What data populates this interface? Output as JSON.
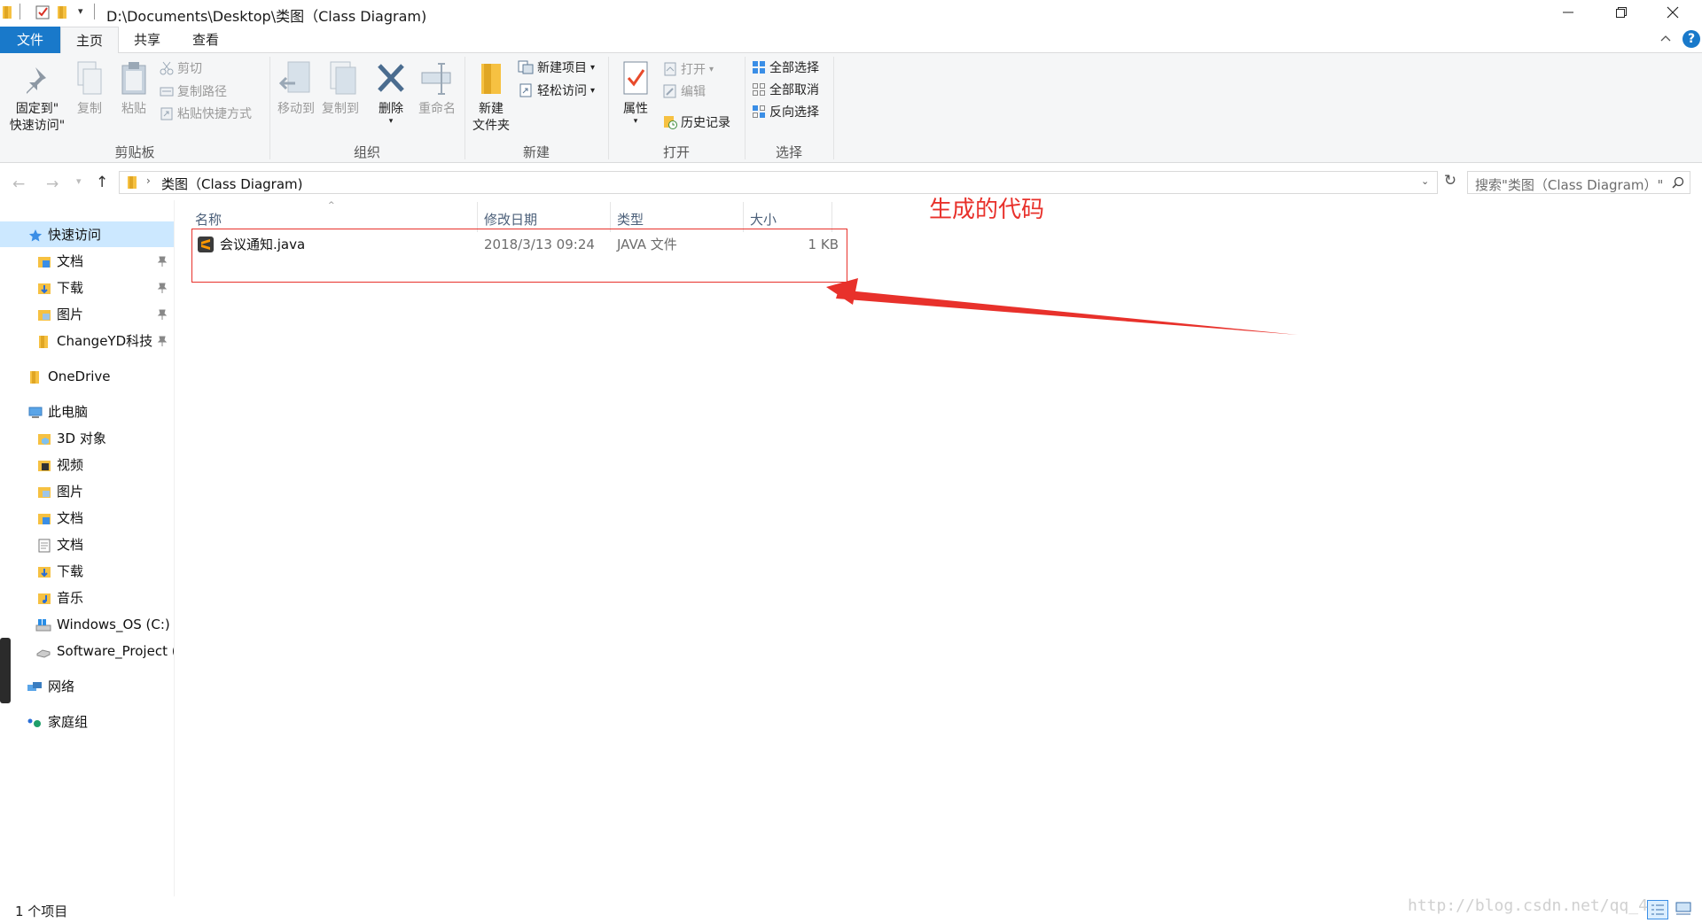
{
  "window": {
    "title": "D:\\Documents\\Desktop\\类图（Class Diagram)"
  },
  "ribbon_tabs": {
    "file": "文件",
    "home": "主页",
    "share": "共享",
    "view": "查看"
  },
  "ribbon": {
    "clipboard": {
      "pin_line1": "固定到\"",
      "pin_line2": "快速访问\"",
      "copy": "复制",
      "paste": "粘贴",
      "cut": "剪切",
      "copy_path": "复制路径",
      "paste_shortcut": "粘贴快捷方式",
      "group": "剪贴板"
    },
    "organize": {
      "move_to": "移动到",
      "copy_to": "复制到",
      "delete": "删除",
      "rename": "重命名",
      "group": "组织"
    },
    "new": {
      "new_folder_line1": "新建",
      "new_folder_line2": "文件夹",
      "new_item": "新建项目",
      "easy_access": "轻松访问",
      "group": "新建"
    },
    "open": {
      "properties": "属性",
      "open": "打开",
      "edit": "编辑",
      "history": "历史记录",
      "group": "打开"
    },
    "select": {
      "select_all": "全部选择",
      "select_none": "全部取消",
      "invert": "反向选择",
      "group": "选择"
    }
  },
  "address": {
    "path": "类图（Class Diagram)",
    "search_placeholder": "搜索\"类图（Class Diagram）\""
  },
  "nav": {
    "quick_access": "快速访问",
    "qa_items": [
      "文档",
      "下载",
      "图片",
      "ChangeYD科技"
    ],
    "onedrive": "OneDrive",
    "this_pc": "此电脑",
    "pc_items": [
      "3D 对象",
      "视频",
      "图片",
      "文档",
      "文档",
      "下载",
      "音乐",
      "Windows_OS (C:)",
      "Software_Project ("
    ],
    "network": "网络",
    "homegroup": "家庭组"
  },
  "columns": {
    "name": "名称",
    "date": "修改日期",
    "type": "类型",
    "size": "大小"
  },
  "files": [
    {
      "name": "会议通知.java",
      "date": "2018/3/13 09:24",
      "type": "JAVA 文件",
      "size": "1 KB"
    }
  ],
  "annotation": "生成的代码",
  "status": "1 个项目",
  "watermark": "http://blog.csdn.net/qq_402",
  "colors": {
    "accent": "#1979ca",
    "selection": "#cce8ff",
    "annotation": "#e8312b",
    "folder": "#f6c142"
  }
}
